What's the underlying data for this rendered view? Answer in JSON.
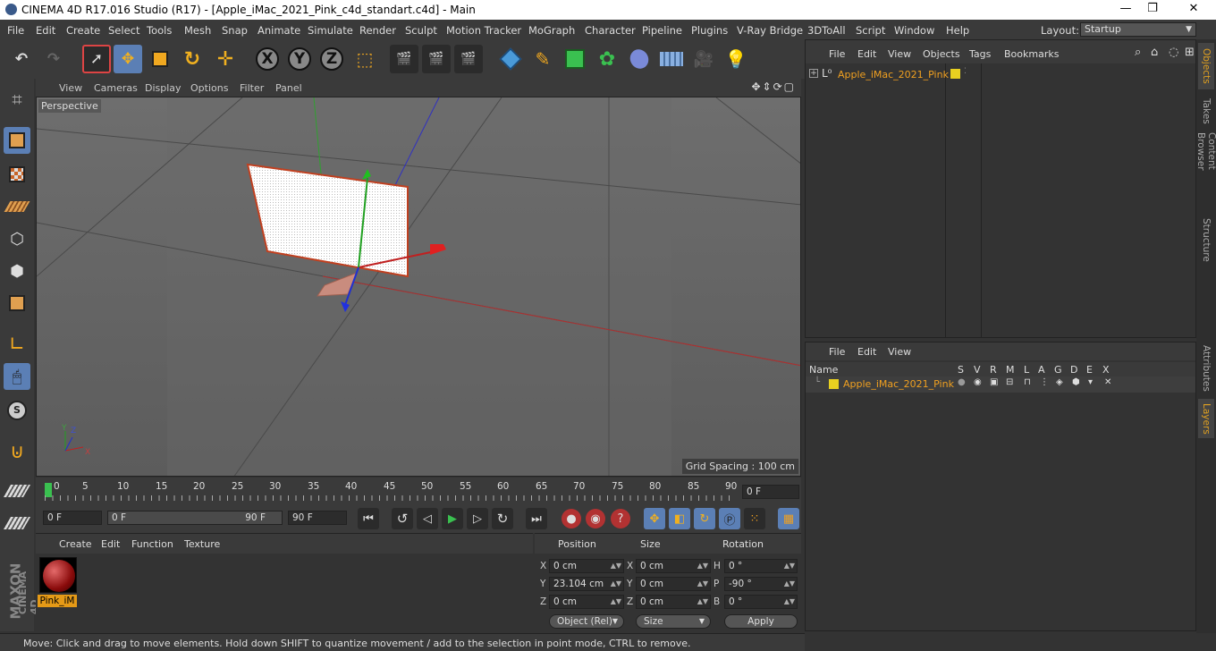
{
  "window": {
    "title": "CINEMA 4D R17.016 Studio (R17) - [Apple_iMac_2021_Pink_c4d_standart.c4d] - Main",
    "controls": [
      "—",
      "❐",
      "✕"
    ]
  },
  "menu": [
    "File",
    "Edit",
    "Create",
    "Select",
    "Tools",
    "Mesh",
    "Snap",
    "Animate",
    "Simulate",
    "Render",
    "Sculpt",
    "Motion Tracker",
    "MoGraph",
    "Character",
    "Pipeline",
    "Plugins",
    "V-Ray Bridge",
    "3DToAll",
    "Script",
    "Window",
    "Help"
  ],
  "layout": {
    "label": "Layout:",
    "value": "Startup"
  },
  "toolbar": {
    "x": "X",
    "y": "Y",
    "z": "Z"
  },
  "viewport": {
    "menu": [
      "View",
      "Cameras",
      "Display",
      "Options",
      "Filter",
      "Panel"
    ],
    "label": "Perspective",
    "grid_spacing": "Grid Spacing : 100 cm",
    "axis": {
      "x": "X",
      "y": "Y",
      "z": "Z"
    }
  },
  "timeline": {
    "ticks": [
      "0",
      "5",
      "10",
      "15",
      "20",
      "25",
      "30",
      "35",
      "40",
      "45",
      "50",
      "55",
      "60",
      "65",
      "70",
      "75",
      "80",
      "85",
      "90"
    ],
    "current": "0 F",
    "start": "0 F",
    "range_start": "0 F",
    "range_end": "90 F",
    "end": "90 F"
  },
  "material": {
    "menu": [
      "Create",
      "Edit",
      "Function",
      "Texture"
    ],
    "name": "Pink_iM"
  },
  "coords": {
    "headers": [
      "Position",
      "Size",
      "Rotation"
    ],
    "axis_labels": [
      "X",
      "Y",
      "Z"
    ],
    "rot_labels": [
      "H",
      "P",
      "B"
    ],
    "pos": [
      "0 cm",
      "23.104 cm",
      "0 cm"
    ],
    "size": [
      "0 cm",
      "0 cm",
      "0 cm"
    ],
    "rot": [
      "0 °",
      "-90 °",
      "0 °"
    ],
    "mode": "Object (Rel)",
    "size_mode": "Size",
    "apply": "Apply"
  },
  "status": "Move: Click and drag to move elements. Hold down SHIFT to quantize movement / add to the selection in point mode, CTRL to remove.",
  "objects": {
    "menu": [
      "File",
      "Edit",
      "View",
      "Objects",
      "Tags",
      "Bookmarks"
    ],
    "item": "Apple_iMac_2021_Pink"
  },
  "layers": {
    "menu": [
      "File",
      "Edit",
      "View"
    ],
    "headers": [
      "Name",
      "S",
      "V",
      "R",
      "M",
      "L",
      "A",
      "G",
      "D",
      "E",
      "X"
    ],
    "item": "Apple_iMac_2021_Pink"
  },
  "side_tabs": [
    "Objects",
    "Takes",
    "Content Browser",
    "Structure",
    "Attributes",
    "Layers"
  ],
  "brand": {
    "maker": "MAXON",
    "product": "CINEMA 4D"
  },
  "colors": {
    "accent": "#5b7fb5",
    "highlight": "#f0a020",
    "layer": "#e8d020"
  }
}
